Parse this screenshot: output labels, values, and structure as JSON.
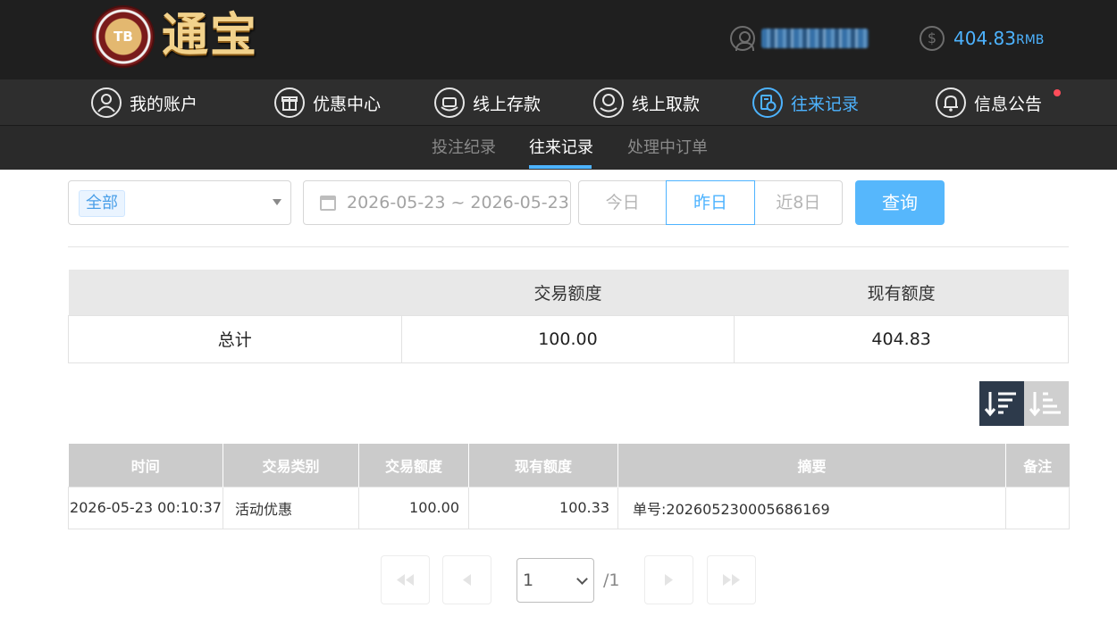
{
  "brand": {
    "badge": "TB",
    "name": "通宝"
  },
  "account": {
    "username": "hyhuodlima",
    "balance": "404.83",
    "currency": "RMB"
  },
  "main_nav": [
    {
      "label": "我的账户",
      "icon": "user-icon"
    },
    {
      "label": "优惠中心",
      "icon": "gift-icon"
    },
    {
      "label": "线上存款",
      "icon": "deposit-icon"
    },
    {
      "label": "线上取款",
      "icon": "withdraw-icon"
    },
    {
      "label": "往来记录",
      "icon": "records-icon",
      "active": true
    },
    {
      "label": "信息公告",
      "icon": "bell-icon",
      "has_notification": true
    }
  ],
  "sub_nav": [
    {
      "label": "投注纪录"
    },
    {
      "label": "往来记录",
      "active": true
    },
    {
      "label": "处理中订单"
    }
  ],
  "filter": {
    "type_selected": "全部",
    "date_range": "2026-05-23 ~ 2026-05-23",
    "quick_ranges": [
      "今日",
      "昨日",
      "近8日"
    ],
    "quick_active": "昨日",
    "query_label": "查询"
  },
  "summary": {
    "headers": [
      "",
      "交易额度",
      "现有额度"
    ],
    "row": {
      "label": "总计",
      "transaction_amount": "100.00",
      "current_balance": "404.83"
    }
  },
  "sort": {
    "active": "desc"
  },
  "records": {
    "headers": [
      "时间",
      "交易类别",
      "交易额度",
      "现有额度",
      "摘要",
      "备注"
    ],
    "rows": [
      {
        "time": "2026-05-23 00:10:37",
        "category": "活动优惠",
        "amount": "100.00",
        "balance": "100.33",
        "summary": "单号:202605230005686169",
        "note": ""
      }
    ]
  },
  "pagination": {
    "current": "1",
    "total": "/1"
  },
  "colors": {
    "accent": "#4db3ff",
    "header_bg": "#1f1f1f",
    "nav_bg": "#2e2e2e",
    "query_button": "#56b7fc",
    "notification_dot": "#ff4d5a"
  }
}
